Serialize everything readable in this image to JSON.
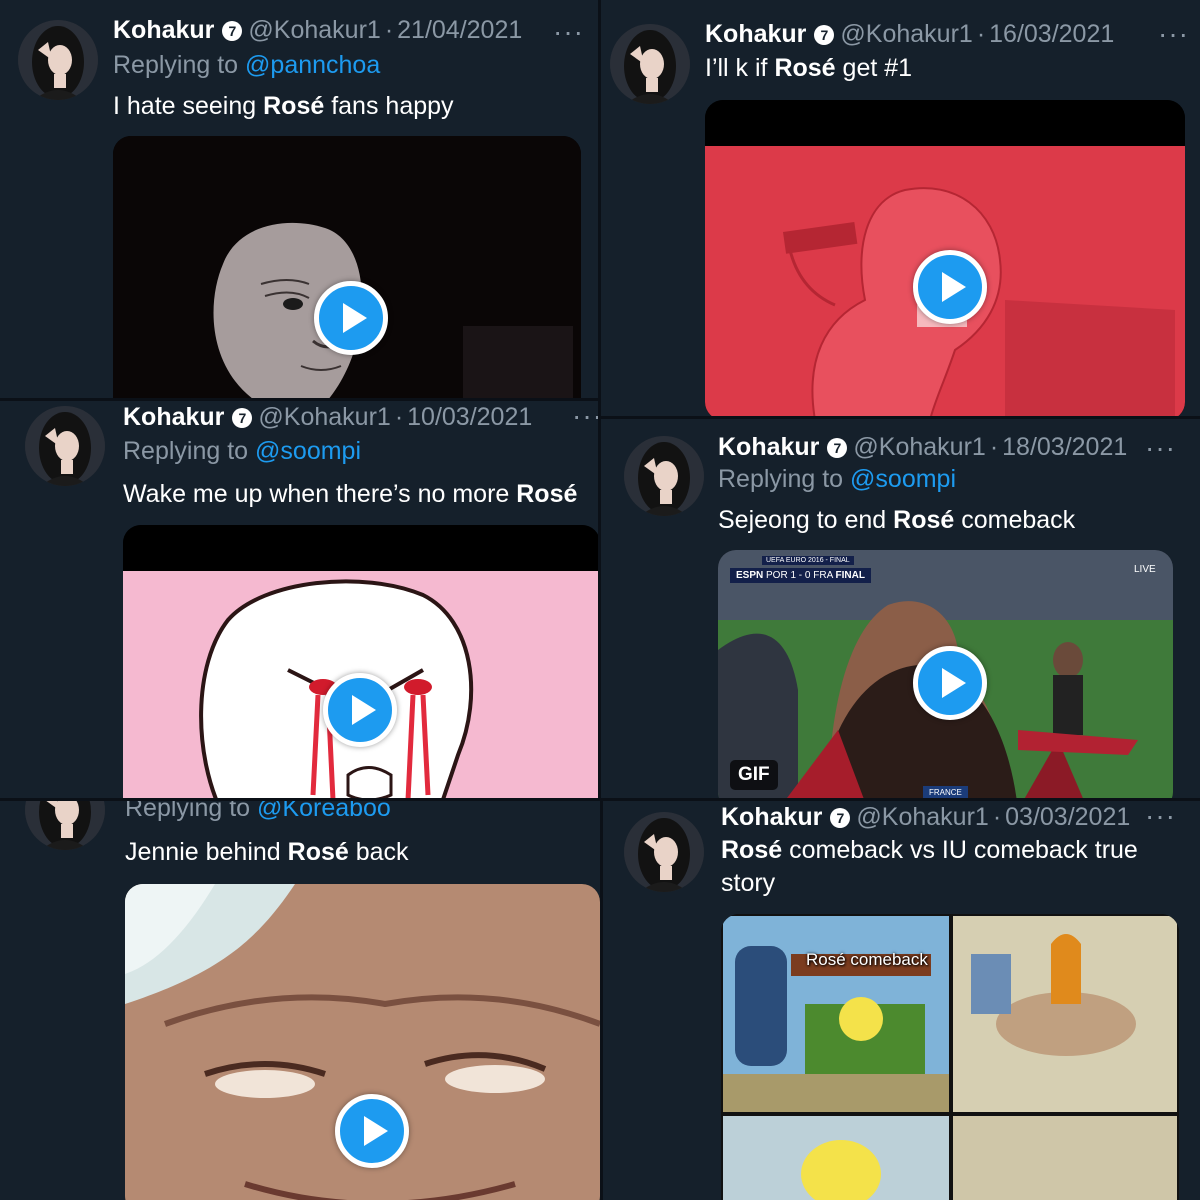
{
  "user": {
    "name": "Kohakur",
    "badge": "7",
    "handle": "@Kohakur1",
    "dot": "·",
    "more": "···"
  },
  "common": {
    "replying_to": "Replying to",
    "highlight": "Rosé"
  },
  "tweets": [
    {
      "date": "21/04/2021",
      "reply_mention": "@pannchoa",
      "text_before": "I hate seeing ",
      "text_after": " fans happy",
      "media_type": "video"
    },
    {
      "date": "16/03/2021",
      "text_before": "I’ll k if ",
      "text_after": " get #1",
      "media_type": "video"
    },
    {
      "date": "10/03/2021",
      "reply_mention": "@soompi",
      "text_before": "Wake me up when there’s no more ",
      "text_after": "",
      "media_type": "video"
    },
    {
      "date": "18/03/2021",
      "reply_mention": "@soompi",
      "text_before": "Sejeong to end ",
      "text_after": " comeback",
      "media_type": "gif",
      "media_badge": "GIF",
      "overlay": {
        "espn": "ESPN",
        "score": "POR  1 - 0  FRA",
        "final": "FINAL",
        "live": "LIVE",
        "event": "UEFA EURO 2016 - FINAL",
        "banner": "FRANCE"
      }
    },
    {
      "reply_mention": "@Koreaboo",
      "text_before": "Jennie behind ",
      "text_after": " back",
      "media_type": "video"
    },
    {
      "date": "03/03/2021",
      "text_before": "",
      "text_after": " comeback vs IU comeback true story",
      "media_type": "image",
      "sign": "Rosé comeback"
    }
  ],
  "colors": {
    "background": "#15202b",
    "accent": "#1d9bf0",
    "muted": "#8b98a5"
  }
}
